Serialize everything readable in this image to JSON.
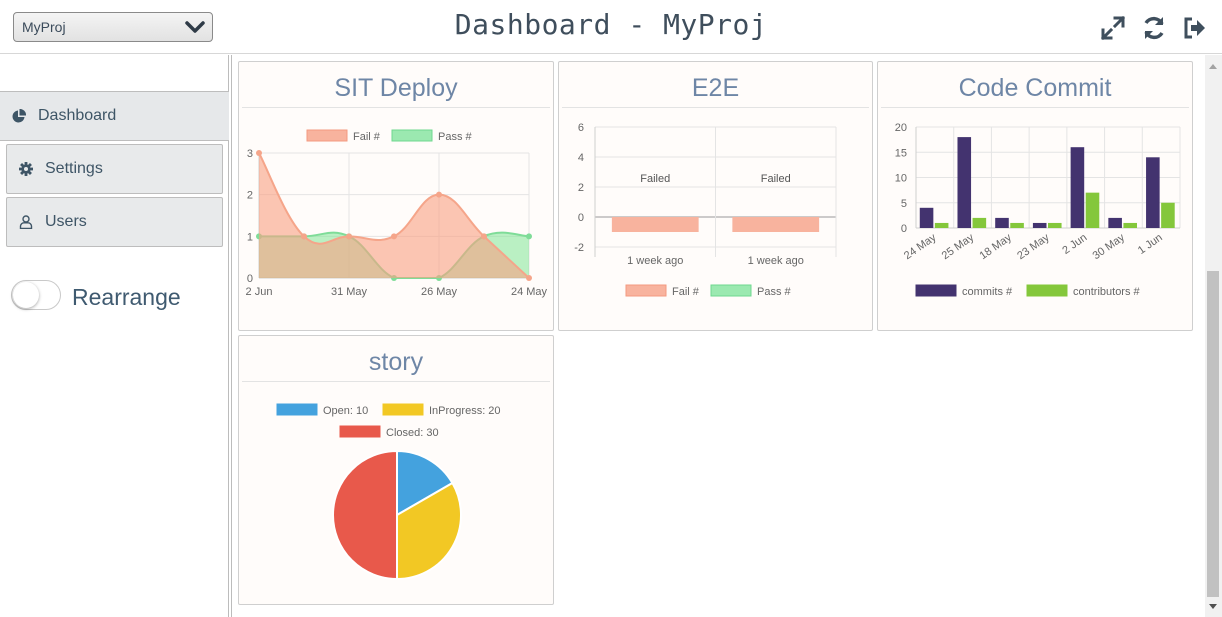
{
  "header": {
    "project_select_value": "MyProj",
    "title": "Dashboard - MyProj",
    "icons": [
      "expand-icon",
      "refresh-icon",
      "sign-out-icon"
    ]
  },
  "sidebar": {
    "items": [
      {
        "label": "Dashboard",
        "icon": "pie-chart-icon",
        "active": true
      },
      {
        "label": "Settings",
        "icon": "gear-icon",
        "active": false
      },
      {
        "label": "Users",
        "icon": "user-icon",
        "active": false
      }
    ],
    "rearrange_label": "Rearrange",
    "rearrange_on": false
  },
  "panels": {
    "sit_deploy": {
      "title": "SIT Deploy"
    },
    "e2e": {
      "title": "E2E"
    },
    "code_commit": {
      "title": "Code Commit"
    },
    "story": {
      "title": "story"
    }
  },
  "colors": {
    "fail": "#f8b39e",
    "pass": "#9be9b0",
    "commits": "#43336f",
    "contributors": "#84c73b",
    "open": "#44a2de",
    "inprogress": "#f2c824",
    "closed": "#e8594b",
    "title": "#6e86a6"
  },
  "chart_data": [
    {
      "id": "sit_deploy",
      "type": "area",
      "x": [
        "2 Jun",
        "31 May",
        "26 May",
        "24 May"
      ],
      "x_points": 8,
      "series": [
        {
          "name": "Fail #",
          "values": [
            3,
            1,
            1,
            1,
            2,
            1,
            0
          ]
        },
        {
          "name": "Pass #",
          "values": [
            1,
            1,
            1,
            0,
            0,
            1,
            1
          ]
        }
      ],
      "ylim": [
        0,
        3
      ],
      "yticks": [
        0,
        1,
        2,
        3
      ],
      "legend": "top"
    },
    {
      "id": "e2e",
      "type": "bar",
      "categories": [
        "1 week ago",
        "1 week ago"
      ],
      "series": [
        {
          "name": "Fail #",
          "values": [
            -1,
            -1
          ]
        },
        {
          "name": "Pass #",
          "values": [
            0,
            0
          ]
        }
      ],
      "data_labels": [
        "Failed",
        "Failed"
      ],
      "ylim": [
        -2,
        6
      ],
      "yticks": [
        -2,
        0,
        2,
        4,
        6
      ],
      "legend": "bottom"
    },
    {
      "id": "code_commit",
      "type": "bar",
      "categories": [
        "24 May",
        "25 May",
        "18 May",
        "23 May",
        "2 Jun",
        "30 May",
        "1 Jun"
      ],
      "series": [
        {
          "name": "commits #",
          "values": [
            4,
            18,
            2,
            1,
            16,
            2,
            14
          ]
        },
        {
          "name": "contributors #",
          "values": [
            1,
            2,
            1,
            1,
            7,
            1,
            5
          ]
        }
      ],
      "ylim": [
        0,
        20
      ],
      "yticks": [
        0,
        5,
        10,
        15,
        20
      ],
      "legend": "bottom"
    },
    {
      "id": "story",
      "type": "pie",
      "slices": [
        {
          "name": "Open: 10",
          "value": 10
        },
        {
          "name": "InProgress: 20",
          "value": 20
        },
        {
          "name": "Closed: 30",
          "value": 30
        }
      ],
      "legend": "top"
    }
  ]
}
